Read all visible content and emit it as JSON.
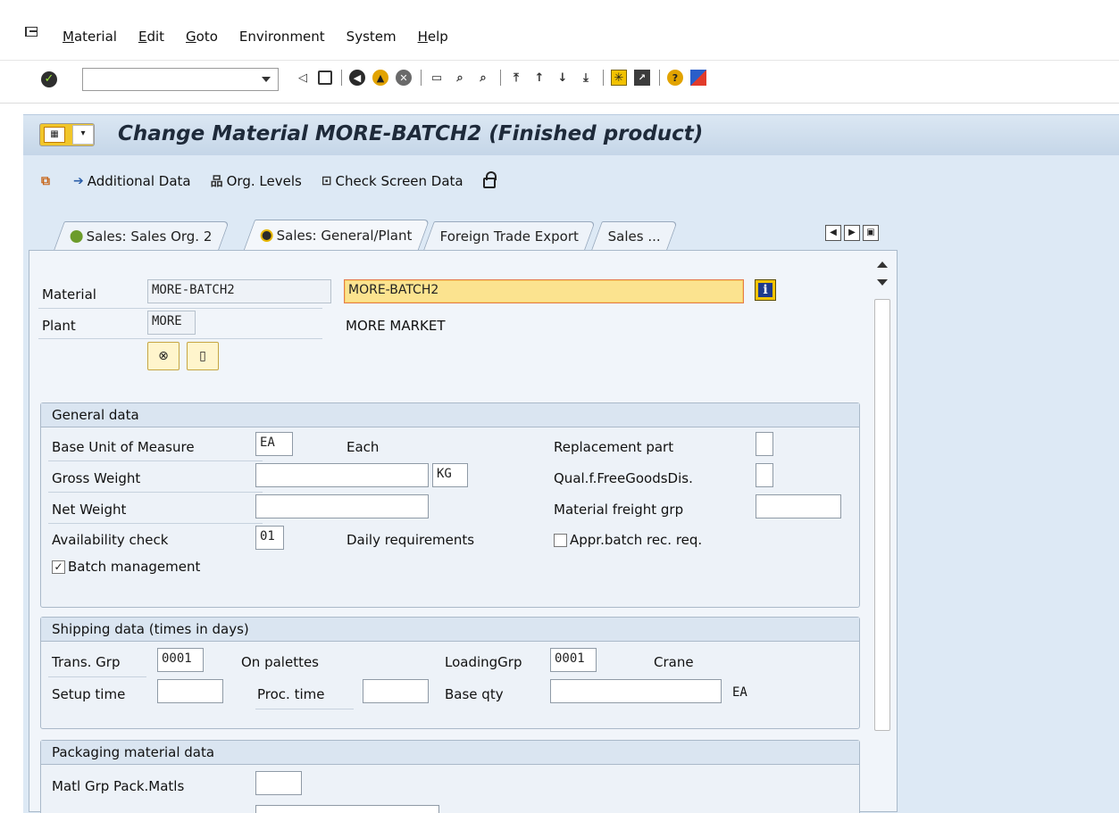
{
  "menu": {
    "items": [
      {
        "label": "Material",
        "underline": "M",
        "rest": "aterial"
      },
      {
        "label": "Edit",
        "underline": "E",
        "rest": "dit"
      },
      {
        "label": "Goto",
        "underline": "G",
        "rest": "oto"
      },
      {
        "label": "Environment",
        "underline": "",
        "rest": "Environment"
      },
      {
        "label": "System",
        "underline": "",
        "rest": "System"
      },
      {
        "label": "Help",
        "underline": "H",
        "rest": "elp"
      }
    ]
  },
  "toolbar": {
    "command_value": ""
  },
  "title": "Change Material MORE-BATCH2 (Finished product)",
  "app_toolbar": {
    "additional_data": "Additional Data",
    "org_levels": "Org. Levels",
    "check_screen_data": "Check Screen Data"
  },
  "tabs": [
    {
      "label": "Sales: Sales Org. 2"
    },
    {
      "label": "Sales: General/Plant"
    },
    {
      "label": "Foreign Trade Export"
    },
    {
      "label": "Sales ..."
    }
  ],
  "header": {
    "material_label": "Material",
    "material_value": "MORE-BATCH2",
    "material_desc": "MORE-BATCH2",
    "plant_label": "Plant",
    "plant_value": "MORE",
    "plant_desc": "MORE MARKET"
  },
  "general_data": {
    "title": "General data",
    "base_uom_label": "Base Unit of Measure",
    "base_uom_value": "EA",
    "base_uom_text": "Each",
    "gross_weight_label": "Gross Weight",
    "gross_weight_value": "",
    "weight_unit": "KG",
    "net_weight_label": "Net Weight",
    "net_weight_value": "",
    "availability_label": "Availability check",
    "availability_value": "01",
    "availability_text": "Daily requirements",
    "batch_label": "Batch management",
    "batch_checked": true,
    "replacement_label": "Replacement part",
    "qual_label": "Qual.f.FreeGoodsDis.",
    "freight_label": "Material freight grp",
    "appr_label": "Appr.batch rec. req.",
    "appr_checked": false
  },
  "shipping_data": {
    "title": "Shipping data (times in days)",
    "trans_grp_label": "Trans. Grp",
    "trans_grp_value": "0001",
    "trans_grp_text": "On palettes",
    "loading_grp_label": "LoadingGrp",
    "loading_grp_value": "0001",
    "loading_grp_text": "Crane",
    "setup_label": "Setup time",
    "setup_value": "",
    "proc_label": "Proc. time",
    "proc_value": "",
    "base_qty_label": "Base qty",
    "base_qty_value": "",
    "base_qty_unit": "EA"
  },
  "packaging": {
    "title": "Packaging material data",
    "matl_grp_label": "Matl Grp Pack.Matls",
    "matl_grp_value": ""
  }
}
